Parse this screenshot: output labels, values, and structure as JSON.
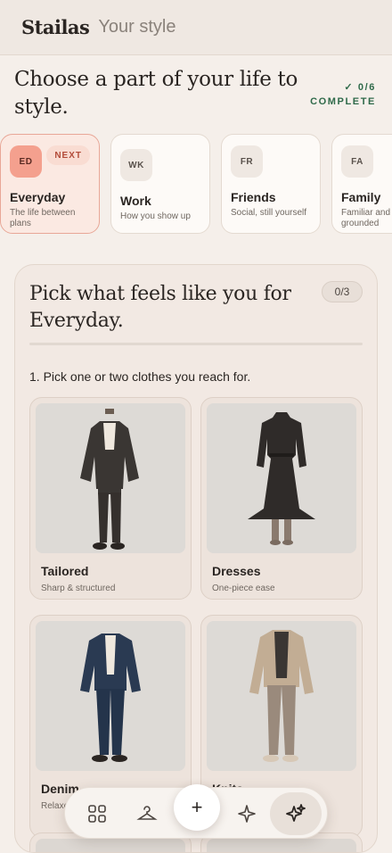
{
  "header": {
    "brand": "Stailas",
    "subtitle": "Your style"
  },
  "intro": {
    "title": "Choose a part of your life to style.",
    "progress_value": "✓ 0/6",
    "progress_label": "COMPLETE"
  },
  "parts": [
    {
      "abbr": "ED",
      "name": "Everyday",
      "desc": "The life between plans",
      "badge": "NEXT",
      "active": true
    },
    {
      "abbr": "WK",
      "name": "Work",
      "desc": "How you show up"
    },
    {
      "abbr": "FR",
      "name": "Friends",
      "desc": "Social, still yourself"
    },
    {
      "abbr": "FA",
      "name": "Family",
      "desc": "Familiar and grounded"
    }
  ],
  "panel": {
    "title": "Pick what feels like you for Everyday.",
    "count": "0/3",
    "question": "1. Pick one or two clothes you reach for.",
    "options": [
      {
        "name": "Tailored",
        "desc": "Sharp & structured"
      },
      {
        "name": "Dresses",
        "desc": "One-piece ease"
      },
      {
        "name": "Denim",
        "desc": "Relaxed"
      },
      {
        "name": "Knits",
        "desc": ""
      }
    ]
  },
  "nav": {
    "add_label": "+",
    "icons": [
      "grid-icon",
      "hanger-icon",
      "add-icon",
      "sparkle-icon",
      "sparkles-icon"
    ]
  },
  "colors": {
    "accent": "#f4a08e",
    "complete_green": "#2f6a4a",
    "background": "#f5efea"
  }
}
